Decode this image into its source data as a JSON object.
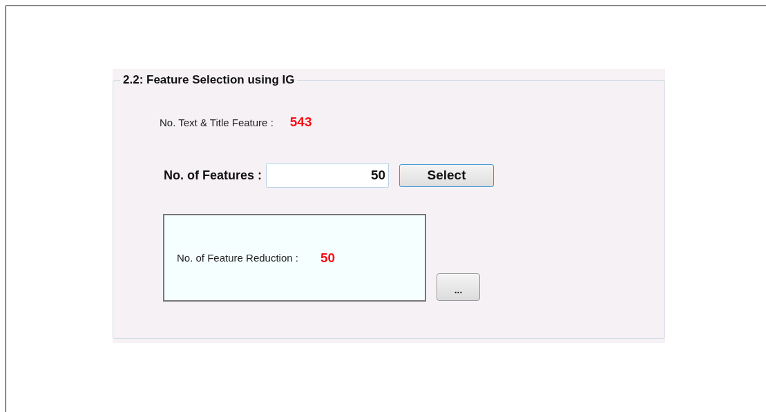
{
  "group": {
    "title": "2.2: Feature Selection using IG"
  },
  "text_title_feature": {
    "label": "No. Text & Title Feature :",
    "value": "543"
  },
  "features": {
    "label": "No. of Features :",
    "value": "50",
    "button": "Select"
  },
  "reduction": {
    "label": "No. of Feature Reduction :",
    "value": "50"
  },
  "more_button": "..."
}
